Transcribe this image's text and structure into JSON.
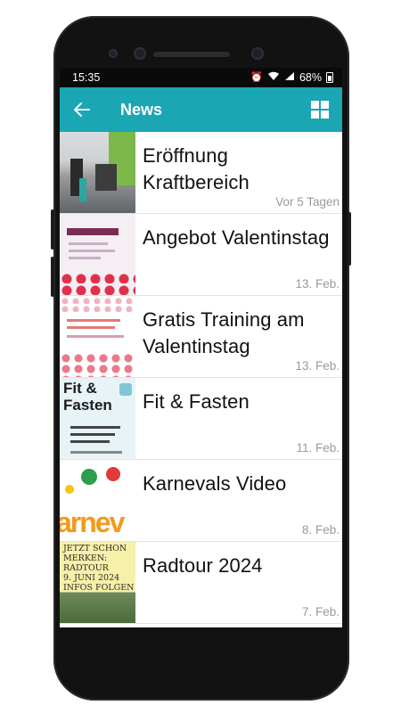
{
  "status_bar": {
    "time": "15:35",
    "battery": "68%",
    "icons": [
      "alarm-icon",
      "wifi-icon",
      "signal-icon",
      "battery-icon"
    ]
  },
  "app_bar": {
    "title": "News",
    "back_icon": "arrow-left-icon",
    "view_icon": "grid-view-icon"
  },
  "colors": {
    "app_bar": "#1aa6b3",
    "status_bar": "#0a0a0a",
    "date_text": "#9a9a9a"
  },
  "news": [
    {
      "title": "Eröffnung\nKraftbereich",
      "date": "Vor 5 Tagen"
    },
    {
      "title": "Angebot Valentinstag",
      "date": "13. Feb."
    },
    {
      "title": "Gratis Training am\nValentinstag",
      "date": "13. Feb."
    },
    {
      "title": "Fit & Fasten",
      "date": "11. Feb."
    },
    {
      "title": "Karnevals Video",
      "date": "8. Feb."
    },
    {
      "title": "Radtour 2024",
      "date": "7. Feb."
    }
  ],
  "thumbnails": {
    "fit_fasten_text": "Fit &\nFasten",
    "karneval_text": "arnev",
    "radtour_note": "JETZT SCHON\nMERKEN:\nRADTOUR\n9. JUNI 2024\nINFOS FOLGEN"
  }
}
